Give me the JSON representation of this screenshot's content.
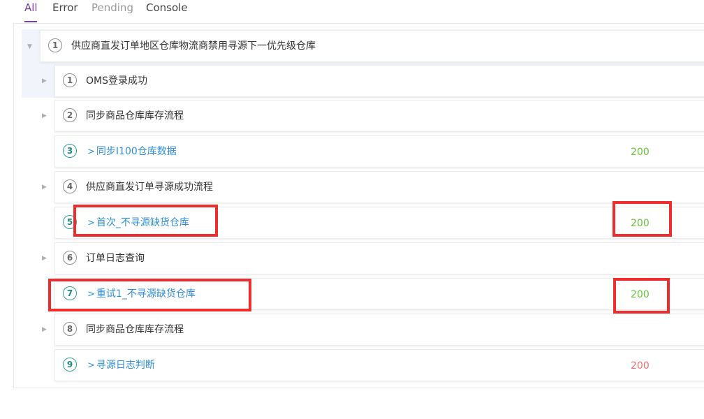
{
  "tabs": {
    "all": "All",
    "error": "Error",
    "pending": "Pending",
    "console": "Console"
  },
  "group": {
    "number": "1",
    "title": "供应商直发订单地区仓库物流商禁用寻源下一优先级仓库"
  },
  "steps": [
    {
      "number": "1",
      "label": "OMS登录成功",
      "type": "group"
    },
    {
      "number": "2",
      "label": "同步商品仓库库存流程",
      "type": "group"
    },
    {
      "number": "3",
      "chevron": ">",
      "label": "同步I100仓库数据",
      "type": "api",
      "status": "200",
      "status_color": "#67c23a"
    },
    {
      "number": "4",
      "label": "供应商直发订单寻源成功流程",
      "type": "group"
    },
    {
      "number": "5",
      "chevron": ">",
      "label": "首次_不寻源缺货仓库",
      "type": "api",
      "status": "200",
      "status_color": "#67c23a"
    },
    {
      "number": "6",
      "label": "订单日志查询",
      "type": "group"
    },
    {
      "number": "7",
      "chevron": ">",
      "label": "重试1_不寻源缺货仓库",
      "type": "api",
      "status": "200",
      "status_color": "#67c23a"
    },
    {
      "number": "8",
      "label": "同步商品仓库库存流程",
      "type": "group"
    },
    {
      "number": "9",
      "chevron": ">",
      "label": "寻源日志判断",
      "type": "api",
      "status": "200",
      "status_color": "#f56c6c"
    }
  ],
  "colors": {
    "active_tab": "#7b3fa0",
    "api_link": "#2f8fd8",
    "highlight": "#ee2e2e"
  }
}
